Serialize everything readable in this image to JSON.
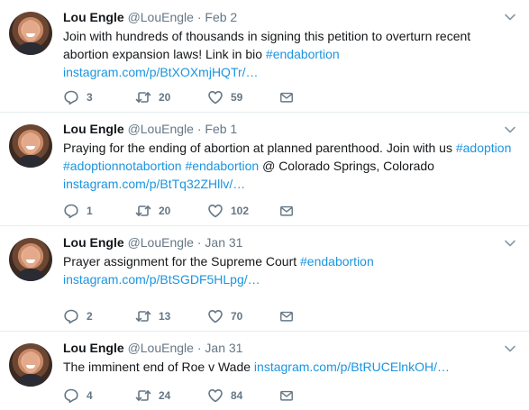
{
  "tweets": [
    {
      "name": "Lou Engle",
      "handle": "@LouEngle",
      "separator": "·",
      "date": "Feb 2",
      "body": [
        [
          {
            "t": "Join with hundreds of thousands in signing this petition to overturn recent",
            "link": false
          }
        ],
        [
          {
            "t": "abortion expansion laws! Link in bio ",
            "link": false
          },
          {
            "t": "#endabortion",
            "link": true
          }
        ],
        [
          {
            "t": "instagram.com/p/BtXOXmjHQTr/…",
            "link": true
          }
        ]
      ],
      "replies": "3",
      "retweets": "20",
      "likes": "59"
    },
    {
      "name": "Lou Engle",
      "handle": "@LouEngle",
      "separator": "·",
      "date": "Feb 1",
      "body": [
        [
          {
            "t": "Praying for the ending of abortion at planned parenthood. Join with us ",
            "link": false
          },
          {
            "t": "#adoption",
            "link": true
          }
        ],
        [
          {
            "t": "#adoptionnotabortion",
            "link": true
          },
          {
            "t": " ",
            "link": false
          },
          {
            "t": "#endabortion",
            "link": true
          },
          {
            "t": " @ Colorado Springs, Colorado",
            "link": false
          }
        ],
        [
          {
            "t": "instagram.com/p/BtTq32ZHllv/…",
            "link": true
          }
        ]
      ],
      "replies": "1",
      "retweets": "20",
      "likes": "102"
    },
    {
      "name": "Lou Engle",
      "handle": "@LouEngle",
      "separator": "·",
      "date": "Jan 31",
      "body": [
        [
          {
            "t": "Prayer assignment for the Supreme Court ",
            "link": false
          },
          {
            "t": "#endabortion",
            "link": true
          }
        ],
        [
          {
            "t": "instagram.com/p/BtSGDF5HLpg/…",
            "link": true
          }
        ]
      ],
      "replies": "2",
      "retweets": "13",
      "likes": "70"
    },
    {
      "name": "Lou Engle",
      "handle": "@LouEngle",
      "separator": "·",
      "date": "Jan 31",
      "body": [
        [
          {
            "t": "The imminent end of Roe v Wade ",
            "link": false
          },
          {
            "t": "instagram.com/p/BtRUCElnkOH/…",
            "link": true
          }
        ]
      ],
      "replies": "4",
      "retweets": "24",
      "likes": "84"
    }
  ],
  "icons": {
    "reply": "reply-icon",
    "retweet": "retweet-icon",
    "like": "heart-icon",
    "message": "envelope-icon",
    "menu": "chevron-down-icon"
  },
  "colors": {
    "link": "#1b95e0",
    "muted": "#657786",
    "text": "#14171a",
    "divider": "#e6ecf0"
  }
}
